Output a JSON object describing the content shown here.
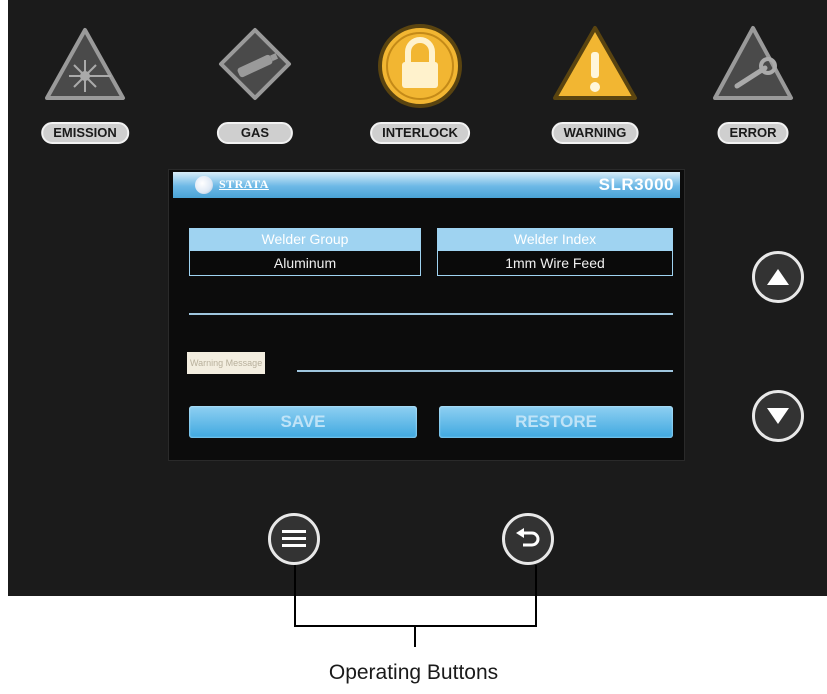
{
  "indicators": [
    {
      "name": "emission",
      "label": "EMISSION",
      "icon": "laser-radiation-icon"
    },
    {
      "name": "gas",
      "label": "GAS",
      "icon": "gas-cylinder-icon"
    },
    {
      "name": "interlock",
      "label": "INTERLOCK",
      "icon": "padlock-icon",
      "color": "#f2b632"
    },
    {
      "name": "warning",
      "label": "WARNING",
      "icon": "warning-icon",
      "color": "#f2b632"
    },
    {
      "name": "error",
      "label": "ERROR",
      "icon": "wrench-icon"
    }
  ],
  "screen": {
    "brand": "STRATA",
    "model": "SLR3000",
    "welder_group": {
      "label": "Welder Group",
      "value": "Aluminum"
    },
    "welder_index": {
      "label": "Welder Index",
      "value": "1mm Wire Feed"
    },
    "warning_message": "Warning Message",
    "save_label": "SAVE",
    "restore_label": "RESTORE"
  },
  "side_buttons": {
    "up": "up-arrow-icon",
    "down": "down-arrow-icon"
  },
  "bottom_buttons": {
    "menu": "menu-icon",
    "back": "back-icon"
  },
  "caption": "Operating Buttons",
  "colors": {
    "accent": "#6cb8e6",
    "active_indicator": "#f2b632"
  }
}
